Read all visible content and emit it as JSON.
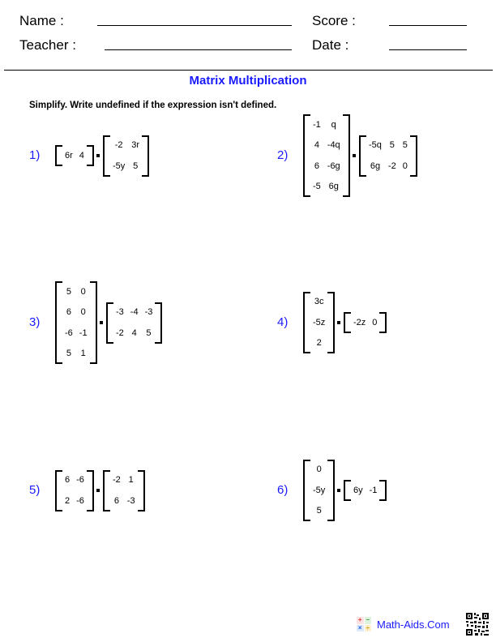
{
  "header": {
    "name_label": "Name :",
    "teacher_label": "Teacher :",
    "score_label": "Score :",
    "date_label": "Date :"
  },
  "title": "Matrix Multiplication",
  "instructions": "Simplify. Write undefined if the expression isn't defined.",
  "problems": [
    {
      "number": "1)",
      "left": [
        [
          "6r",
          "4"
        ]
      ],
      "right": [
        [
          "-2",
          "3r"
        ],
        [
          "-5y",
          "5"
        ]
      ]
    },
    {
      "number": "2)",
      "left": [
        [
          "-1",
          "q"
        ],
        [
          "4",
          "-4q"
        ],
        [
          "6",
          "-6g"
        ],
        [
          "-5",
          "6g"
        ]
      ],
      "right": [
        [
          "-5q",
          "5",
          "5"
        ],
        [
          "6g",
          "-2",
          "0"
        ]
      ]
    },
    {
      "number": "3)",
      "left": [
        [
          "5",
          "0"
        ],
        [
          "6",
          "0"
        ],
        [
          "-6",
          "-1"
        ],
        [
          "5",
          "1"
        ]
      ],
      "right": [
        [
          "-3",
          "-4",
          "-3"
        ],
        [
          "-2",
          "4",
          "5"
        ]
      ]
    },
    {
      "number": "4)",
      "left": [
        [
          "3c"
        ],
        [
          "-5z"
        ],
        [
          "2"
        ]
      ],
      "right": [
        [
          "-2z",
          "0"
        ]
      ]
    },
    {
      "number": "5)",
      "left": [
        [
          "6",
          "-6"
        ],
        [
          "2",
          "-6"
        ]
      ],
      "right": [
        [
          "-2",
          "1"
        ],
        [
          "6",
          "-3"
        ]
      ]
    },
    {
      "number": "6)",
      "left": [
        [
          "0"
        ],
        [
          "-5y"
        ],
        [
          "5"
        ]
      ],
      "right": [
        [
          "6y",
          "-1"
        ]
      ]
    }
  ],
  "footer": {
    "brand": "Math-Aids.Com",
    "logo_icon": "calculator-icon",
    "logo_glyphs": [
      "+",
      "−",
      "×",
      "÷"
    ],
    "qr_icon": "qr-code-icon"
  },
  "colors": {
    "accent": "#1a1aff",
    "logo": [
      "#e53935",
      "#43a047",
      "#1e5fd6",
      "#f4b400"
    ]
  }
}
